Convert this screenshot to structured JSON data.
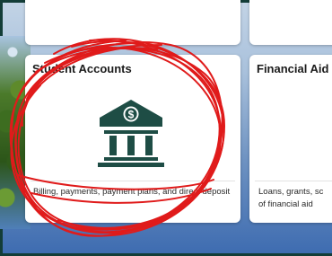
{
  "cards": [
    {
      "title": "Student Accounts",
      "icon": "bank-dollar-icon",
      "description": "Billing, payments, payment plans, and direct deposit"
    },
    {
      "title": "Financial Aid",
      "description_line1": "Loans, grants, sc",
      "description_line2": "of financial aid"
    }
  ],
  "colors": {
    "icon": "#1e4d45",
    "annotation": "#e01b1b",
    "frame": "#133d38"
  }
}
